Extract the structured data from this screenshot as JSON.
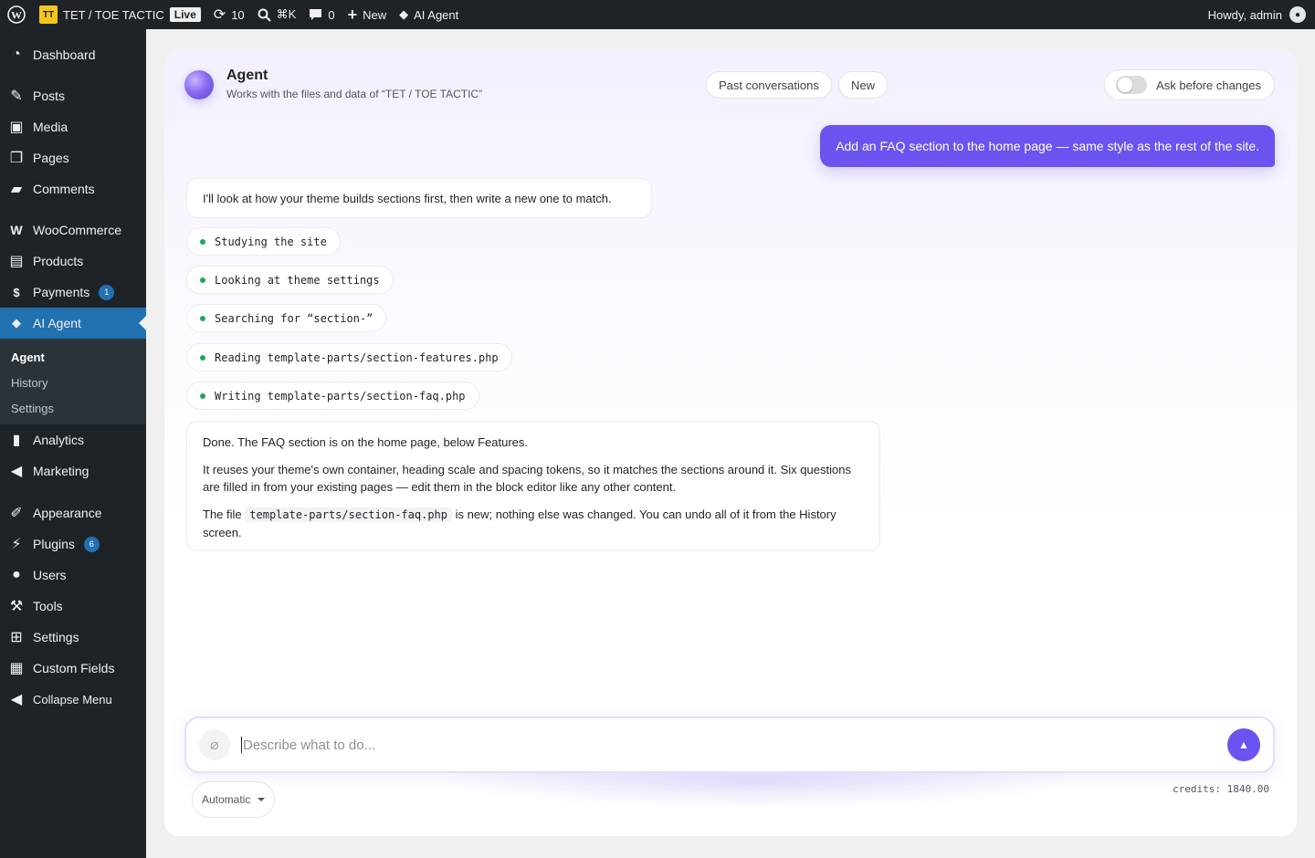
{
  "adminbar": {
    "site_logo_text": "TT",
    "site_name": "TET / TOE TACTIC",
    "live_label": "Live",
    "updates_count": "10",
    "search_shortcut": "⌘K",
    "comments_count": "0",
    "new_label": "New",
    "ai_agent_label": "AI Agent",
    "howdy": "Howdy, admin"
  },
  "sidebar": {
    "items": [
      {
        "label": "Dashboard",
        "icon": "dashboard-icon"
      },
      {
        "label": "Posts",
        "icon": "pin-icon"
      },
      {
        "label": "Media",
        "icon": "media-icon"
      },
      {
        "label": "Pages",
        "icon": "pages-icon"
      },
      {
        "label": "Comments",
        "icon": "comment-icon"
      },
      {
        "label": "WooCommerce",
        "icon": "woo-icon"
      },
      {
        "label": "Products",
        "icon": "archive-icon"
      },
      {
        "label": "Payments",
        "icon": "dollar-icon",
        "badge": "1"
      },
      {
        "label": "AI Agent",
        "icon": "diamond-icon"
      },
      {
        "label": "Analytics",
        "icon": "bar-chart-icon"
      },
      {
        "label": "Marketing",
        "icon": "megaphone-icon"
      },
      {
        "label": "Appearance",
        "icon": "brush-icon"
      },
      {
        "label": "Plugins",
        "icon": "plug-icon",
        "badge": "6"
      },
      {
        "label": "Users",
        "icon": "user-icon"
      },
      {
        "label": "Tools",
        "icon": "wrench-icon"
      },
      {
        "label": "Settings",
        "icon": "sliders-icon"
      },
      {
        "label": "Custom Fields",
        "icon": "grid-icon"
      },
      {
        "label": "Collapse Menu",
        "icon": "collapse-icon"
      }
    ],
    "submenu": [
      "Agent",
      "History",
      "Settings"
    ]
  },
  "agent": {
    "title": "Agent",
    "subtitle": "Works with the files and data of “TET / TOE TACTIC”",
    "past_conversations": "Past conversations",
    "new_button": "New",
    "ask_before_changes": "Ask before changes",
    "ask_before_changes_enabled": false
  },
  "conversation": {
    "user_message": "Add an FAQ section to the home page — same style as the rest of the site.",
    "agent_intro": "I'll look at how your theme builds sections first, then write a new one to match.",
    "steps": [
      "Studying the site",
      "Looking at theme settings",
      "Searching for “section-”",
      "Reading template-parts/section-features.php",
      "Writing template-parts/section-faq.php"
    ],
    "done_p1": "Done. The FAQ section is on the home page, below Features.",
    "done_p2": "It reuses your theme's own container, heading scale and spacing tokens, so it matches the sections around it. Six questions are filled in from your existing pages — edit them in the block editor like any other content.",
    "done_p3_before": "The file",
    "done_p3_code": "template-parts/section-faq.php",
    "done_p3_after": "is new; nothing else was changed. You can undo all of it from the History screen."
  },
  "composer": {
    "placeholder": "Describe what to do...",
    "value": "",
    "model": "Automatic",
    "credits": "credits: 1840.00"
  },
  "colors": {
    "accent": "#6b53f0",
    "admin_dark": "#1d2327",
    "wp_blue": "#2271b1",
    "step_dot": "#1fa55a"
  }
}
